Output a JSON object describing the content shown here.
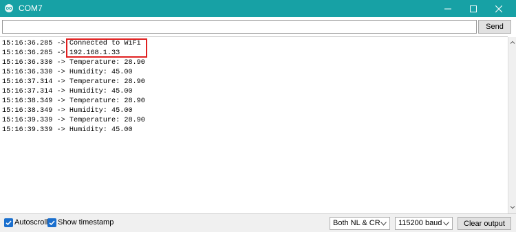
{
  "window": {
    "title": "COM7",
    "accent_color": "#17a1a5",
    "icons": [
      "arduino-icon",
      "minimize-icon",
      "maximize-icon",
      "close-icon"
    ]
  },
  "input": {
    "value": "",
    "send_label": "Send"
  },
  "output": {
    "lines": [
      {
        "timestamp": "15:16:36.285",
        "arrow": "->",
        "message": "Connected to WiFi"
      },
      {
        "timestamp": "15:16:36.285",
        "arrow": "->",
        "message": "192.168.1.33"
      },
      {
        "timestamp": "15:16:36.330",
        "arrow": "->",
        "message": "Temperature: 28.90"
      },
      {
        "timestamp": "15:16:36.330",
        "arrow": "->",
        "message": "Humidity: 45.00"
      },
      {
        "timestamp": "15:16:37.314",
        "arrow": "->",
        "message": "Temperature: 28.90"
      },
      {
        "timestamp": "15:16:37.314",
        "arrow": "->",
        "message": "Humidity: 45.00"
      },
      {
        "timestamp": "15:16:38.349",
        "arrow": "->",
        "message": "Temperature: 28.90"
      },
      {
        "timestamp": "15:16:38.349",
        "arrow": "->",
        "message": "Humidity: 45.00"
      },
      {
        "timestamp": "15:16:39.339",
        "arrow": "->",
        "message": "Temperature: 28.90"
      },
      {
        "timestamp": "15:16:39.339",
        "arrow": "->",
        "message": "Humidity: 45.00"
      }
    ],
    "highlight_color": "#e02020"
  },
  "footer": {
    "autoscroll_label": "Autoscroll",
    "autoscroll_checked": true,
    "timestamp_label": "Show timestamp",
    "timestamp_checked": true,
    "line_ending": "Both NL & CR",
    "baud_rate": "115200 baud",
    "clear_label": "Clear output",
    "checkbox_color": "#1a6fce"
  }
}
